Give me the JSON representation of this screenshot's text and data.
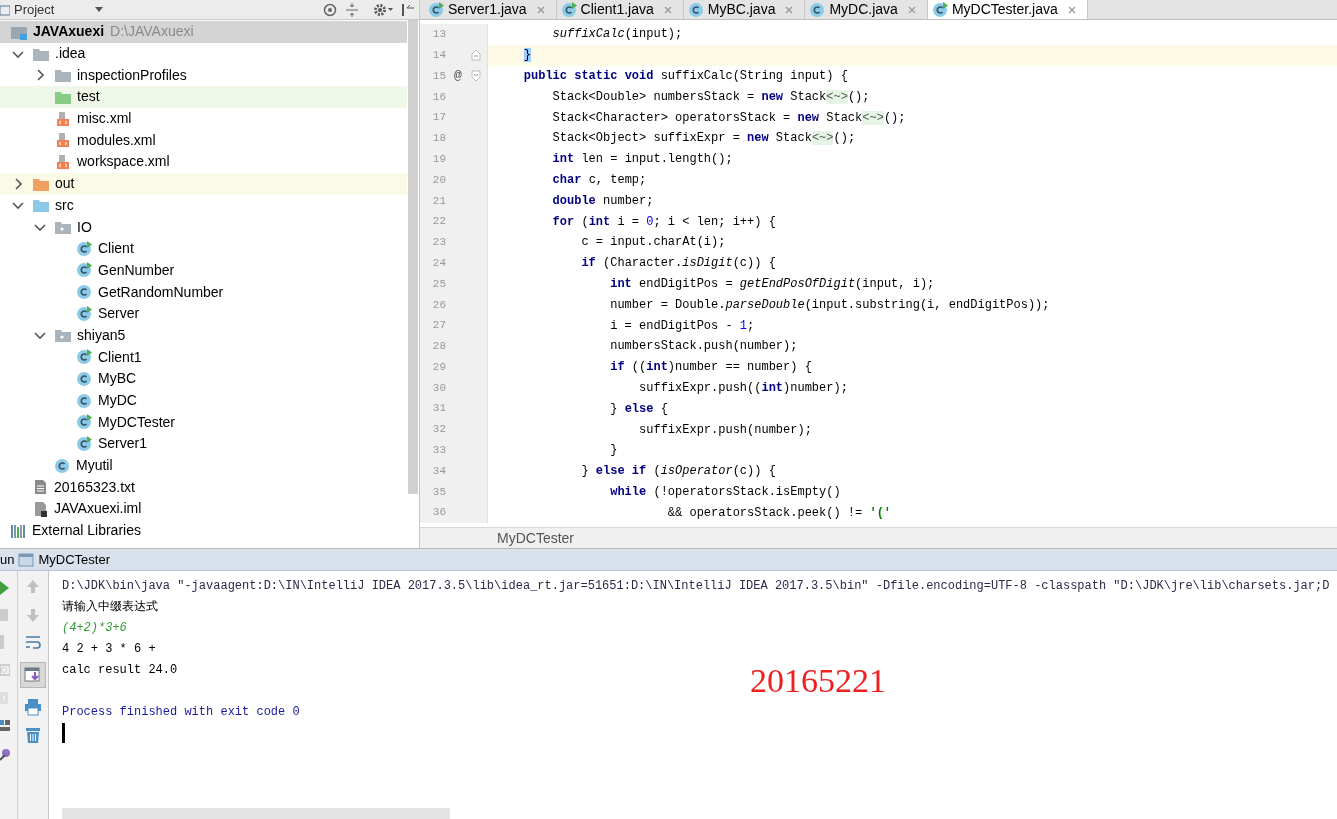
{
  "project_panel": {
    "title": "Project",
    "tree": [
      {
        "label": "JAVAxuexi",
        "path": "D:\\JAVAxuexi",
        "kind": "module",
        "expanded": true,
        "selected": true,
        "children": [
          {
            "label": ".idea",
            "kind": "folder",
            "expanded": true,
            "selected": false,
            "children": [
              {
                "label": "inspectionProfiles",
                "kind": "folder",
                "expanded": false,
                "selected": false
              },
              {
                "label": "test",
                "kind": "test-folder",
                "selected": false
              },
              {
                "label": "misc.xml",
                "kind": "xml",
                "selected": false
              },
              {
                "label": "modules.xml",
                "kind": "xml",
                "selected": false
              },
              {
                "label": "workspace.xml",
                "kind": "xml",
                "selected": false
              }
            ]
          },
          {
            "label": "out",
            "kind": "excluded-folder",
            "expanded": false,
            "selected": false
          },
          {
            "label": "src",
            "kind": "source-folder",
            "expanded": true,
            "selected": false,
            "children": [
              {
                "label": "IO",
                "kind": "package",
                "expanded": true,
                "selected": false,
                "children": [
                  {
                    "label": "Client",
                    "kind": "runnable-class",
                    "selected": false
                  },
                  {
                    "label": "GenNumber",
                    "kind": "runnable-class",
                    "selected": false
                  },
                  {
                    "label": "GetRandomNumber",
                    "kind": "class",
                    "selected": false
                  },
                  {
                    "label": "Server",
                    "kind": "runnable-class",
                    "selected": false
                  }
                ]
              },
              {
                "label": "shiyan5",
                "kind": "package",
                "expanded": true,
                "selected": false,
                "children": [
                  {
                    "label": "Client1",
                    "kind": "runnable-class",
                    "selected": false
                  },
                  {
                    "label": "MyBC",
                    "kind": "class",
                    "selected": false
                  },
                  {
                    "label": "MyDC",
                    "kind": "class",
                    "selected": false
                  },
                  {
                    "label": "MyDCTester",
                    "kind": "runnable-class",
                    "selected": false
                  },
                  {
                    "label": "Server1",
                    "kind": "runnable-class",
                    "selected": false
                  }
                ]
              },
              {
                "label": "Myutil",
                "kind": "class",
                "selected": false
              }
            ]
          },
          {
            "label": "20165323.txt",
            "kind": "text-file",
            "selected": false
          },
          {
            "label": "JAVAxuexi.iml",
            "kind": "module-file",
            "selected": false
          }
        ]
      },
      {
        "label": "External Libraries",
        "kind": "libraries",
        "selected": false
      }
    ]
  },
  "tabs": [
    {
      "label": "Server1.java",
      "kind": "runnable-class",
      "selected": false
    },
    {
      "label": "Client1.java",
      "kind": "runnable-class",
      "selected": false
    },
    {
      "label": "MyBC.java",
      "kind": "class",
      "selected": false
    },
    {
      "label": "MyDC.java",
      "kind": "class",
      "selected": false
    },
    {
      "label": "MyDCTester.java",
      "kind": "runnable-class",
      "selected": true
    }
  ],
  "editor": {
    "lines": [
      {
        "n": "13",
        "kind": "plain",
        "current": false,
        "tokens": [
          {
            "text": "        suffixCalc",
            "kind": "italic"
          },
          {
            "text": "(input);",
            "kind": "plain"
          }
        ]
      },
      {
        "n": "14",
        "kind": "fold-end",
        "current": true,
        "tokens": [
          {
            "text": "    }",
            "kind": "brace"
          }
        ]
      },
      {
        "n": "15",
        "kind": "fold-start",
        "current": false,
        "marker": "@",
        "tokens": [
          {
            "text": "    public static void",
            "kind": "keyword"
          },
          {
            "text": " suffixCalc(String input) {",
            "kind": "plain"
          }
        ]
      },
      {
        "n": "16",
        "kind": "plain",
        "current": false,
        "tokens": [
          {
            "text": "        Stack<Double> numbersStack = ",
            "kind": "plain"
          },
          {
            "text": "new",
            "kind": "keyword"
          },
          {
            "text": " Stack",
            "kind": "plain"
          },
          {
            "text": "<~>",
            "kind": "folded"
          },
          {
            "text": "();",
            "kind": "plain"
          }
        ]
      },
      {
        "n": "17",
        "kind": "plain",
        "current": false,
        "tokens": [
          {
            "text": "        Stack<Character> operatorsStack = ",
            "kind": "plain"
          },
          {
            "text": "new",
            "kind": "keyword"
          },
          {
            "text": " Stack",
            "kind": "plain"
          },
          {
            "text": "<~>",
            "kind": "folded"
          },
          {
            "text": "();",
            "kind": "plain"
          }
        ]
      },
      {
        "n": "18",
        "kind": "plain",
        "current": false,
        "tokens": [
          {
            "text": "        Stack<Object> suffixExpr = ",
            "kind": "plain"
          },
          {
            "text": "new",
            "kind": "keyword"
          },
          {
            "text": " Stack",
            "kind": "plain"
          },
          {
            "text": "<~>",
            "kind": "folded"
          },
          {
            "text": "();",
            "kind": "plain"
          }
        ]
      },
      {
        "n": "19",
        "kind": "plain",
        "current": false,
        "tokens": [
          {
            "text": "        int",
            "kind": "keyword"
          },
          {
            "text": " len = input.length();",
            "kind": "plain"
          }
        ]
      },
      {
        "n": "20",
        "kind": "plain",
        "current": false,
        "tokens": [
          {
            "text": "        char",
            "kind": "keyword"
          },
          {
            "text": " c, temp;",
            "kind": "plain"
          }
        ]
      },
      {
        "n": "21",
        "kind": "plain",
        "current": false,
        "tokens": [
          {
            "text": "        double",
            "kind": "keyword"
          },
          {
            "text": " number;",
            "kind": "plain"
          }
        ]
      },
      {
        "n": "22",
        "kind": "plain",
        "current": false,
        "tokens": [
          {
            "text": "        for",
            "kind": "keyword"
          },
          {
            "text": " (",
            "kind": "plain"
          },
          {
            "text": "int",
            "kind": "keyword"
          },
          {
            "text": " i = ",
            "kind": "plain"
          },
          {
            "text": "0",
            "kind": "number"
          },
          {
            "text": "; i < len; i++) {",
            "kind": "plain"
          }
        ]
      },
      {
        "n": "23",
        "kind": "plain",
        "current": false,
        "tokens": [
          {
            "text": "            c = input.charAt(i);",
            "kind": "plain"
          }
        ]
      },
      {
        "n": "24",
        "kind": "plain",
        "current": false,
        "tokens": [
          {
            "text": "            if",
            "kind": "keyword"
          },
          {
            "text": " (Character.",
            "kind": "plain"
          },
          {
            "text": "isDigit",
            "kind": "italic"
          },
          {
            "text": "(c)) {",
            "kind": "plain"
          }
        ]
      },
      {
        "n": "25",
        "kind": "plain",
        "current": false,
        "tokens": [
          {
            "text": "                int",
            "kind": "keyword"
          },
          {
            "text": " endDigitPos = ",
            "kind": "plain"
          },
          {
            "text": "getEndPosOfDigit",
            "kind": "italic"
          },
          {
            "text": "(input, i);",
            "kind": "plain"
          }
        ]
      },
      {
        "n": "26",
        "kind": "plain",
        "current": false,
        "tokens": [
          {
            "text": "                number = Double.",
            "kind": "plain"
          },
          {
            "text": "parseDouble",
            "kind": "italic"
          },
          {
            "text": "(input.substring(i, endDigitPos));",
            "kind": "plain"
          }
        ]
      },
      {
        "n": "27",
        "kind": "plain",
        "current": false,
        "tokens": [
          {
            "text": "                i = endDigitPos - ",
            "kind": "plain"
          },
          {
            "text": "1",
            "kind": "number"
          },
          {
            "text": ";",
            "kind": "plain"
          }
        ]
      },
      {
        "n": "28",
        "kind": "plain",
        "current": false,
        "tokens": [
          {
            "text": "                numbersStack.push(number);",
            "kind": "plain"
          }
        ]
      },
      {
        "n": "29",
        "kind": "plain",
        "current": false,
        "tokens": [
          {
            "text": "                if",
            "kind": "keyword"
          },
          {
            "text": " ((",
            "kind": "plain"
          },
          {
            "text": "int",
            "kind": "keyword"
          },
          {
            "text": ")number == number) {",
            "kind": "plain"
          }
        ]
      },
      {
        "n": "30",
        "kind": "plain",
        "current": false,
        "tokens": [
          {
            "text": "                    suffixExpr.push((",
            "kind": "plain"
          },
          {
            "text": "int",
            "kind": "keyword"
          },
          {
            "text": ")number);",
            "kind": "plain"
          }
        ]
      },
      {
        "n": "31",
        "kind": "plain",
        "current": false,
        "tokens": [
          {
            "text": "                } ",
            "kind": "plain"
          },
          {
            "text": "else",
            "kind": "keyword"
          },
          {
            "text": " {",
            "kind": "plain"
          }
        ]
      },
      {
        "n": "32",
        "kind": "plain",
        "current": false,
        "tokens": [
          {
            "text": "                    suffixExpr.push(number);",
            "kind": "plain"
          }
        ]
      },
      {
        "n": "33",
        "kind": "plain",
        "current": false,
        "tokens": [
          {
            "text": "                }",
            "kind": "plain"
          }
        ]
      },
      {
        "n": "34",
        "kind": "plain",
        "current": false,
        "tokens": [
          {
            "text": "            } ",
            "kind": "plain"
          },
          {
            "text": "else if",
            "kind": "keyword"
          },
          {
            "text": " (",
            "kind": "plain"
          },
          {
            "text": "isOperator",
            "kind": "italic"
          },
          {
            "text": "(c)) {",
            "kind": "plain"
          }
        ]
      },
      {
        "n": "35",
        "kind": "plain",
        "current": false,
        "tokens": [
          {
            "text": "                while",
            "kind": "keyword"
          },
          {
            "text": " (!operatorsStack.isEmpty()",
            "kind": "plain"
          }
        ]
      },
      {
        "n": "36",
        "kind": "plain",
        "current": false,
        "tokens": [
          {
            "text": "                        && operatorsStack.peek() != ",
            "kind": "plain"
          },
          {
            "text": "'('",
            "kind": "string"
          }
        ]
      }
    ],
    "breadcrumb": "MyDCTester"
  },
  "run_panel": {
    "label": "un",
    "config": "MyDCTester",
    "console": [
      {
        "kind": "command",
        "text": "D:\\JDK\\bin\\java \"-javaagent:D:\\IN\\IntelliJ IDEA 2017.3.5\\lib\\idea_rt.jar=51651:D:\\IN\\IntelliJ IDEA 2017.3.5\\bin\" -Dfile.encoding=UTF-8 -classpath \"D:\\JDK\\jre\\lib\\charsets.jar;D"
      },
      {
        "kind": "output",
        "text": "请输入中缀表达式"
      },
      {
        "kind": "input",
        "text": "(4+2)*3+6"
      },
      {
        "kind": "output",
        "text": "4 2 + 3 * 6 +"
      },
      {
        "kind": "output",
        "text": "calc result 24.0"
      },
      {
        "kind": "blank"
      },
      {
        "kind": "system",
        "text": "Process finished with exit code 0"
      }
    ],
    "annotation": "20165221"
  }
}
